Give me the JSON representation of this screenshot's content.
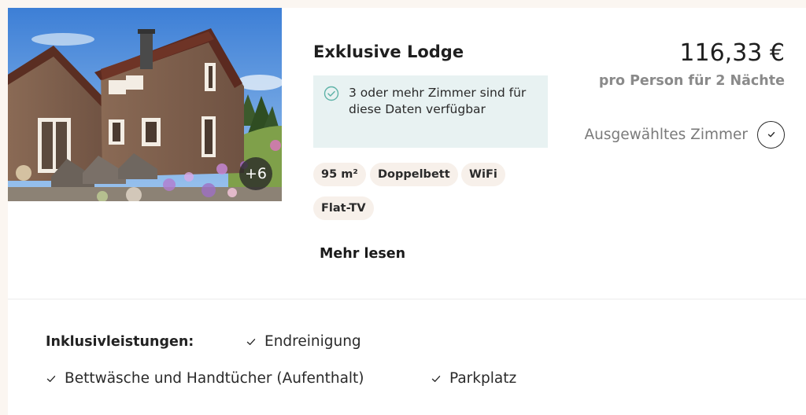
{
  "photo": {
    "alt_icon": "lodge-photo",
    "more_count_label": "+6"
  },
  "room": {
    "title": "Exklusive Lodge",
    "availability_text": "3 oder mehr Zimmer sind für diese Daten verfügbar",
    "availability_icon": "check-circle-icon",
    "features": [
      "95 m²",
      "Doppelbett",
      "WiFi",
      "Flat-TV"
    ],
    "read_more_label": "Mehr lesen"
  },
  "pricing": {
    "price": "116,33 €",
    "note": "pro Person für 2 Nächte",
    "selected_label": "Ausgewähltes Zimmer",
    "selected_icon": "check-icon"
  },
  "inclusions": {
    "heading": "Inklusivleistungen:",
    "items": [
      "Endreinigung",
      "Bettwäsche und Handtücher (Aufenthalt)",
      "Parkplatz"
    ],
    "item_icon": "check-icon"
  },
  "colors": {
    "availability_bg": "#e8f2f2",
    "availability_check": "#5fb3a8",
    "tag_bg": "#f7f0ea",
    "muted_text": "#8a8a8a"
  }
}
